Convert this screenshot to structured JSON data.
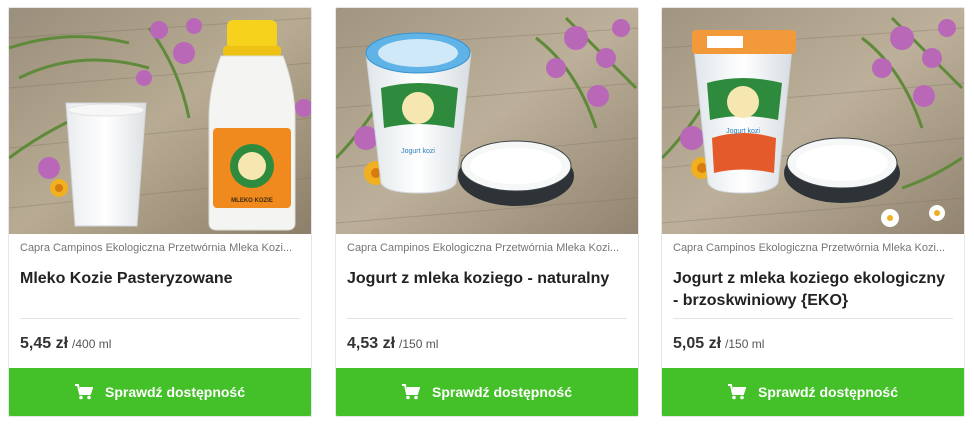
{
  "products": [
    {
      "producer": "Capra Campinos Ekologiczna Przetwórnia Mleka Kozi...",
      "title": "Mleko Kozie Pasteryzowane",
      "price": "5,45 zł",
      "unit": "/400 ml",
      "cta": "Sprawdź dostępność",
      "label_text": "MLEKO KOZIE"
    },
    {
      "producer": "Capra Campinos Ekologiczna Przetwórnia Mleka Kozi...",
      "title": "Jogurt z mleka koziego - naturalny",
      "price": "4,53 zł",
      "unit": "/150 ml",
      "cta": "Sprawdź dostępność",
      "label_text": "Jogurt kozi"
    },
    {
      "producer": "Capra Campinos Ekologiczna Przetwórnia Mleka Kozi...",
      "title": "Jogurt z mleka koziego ekologiczny - brzoskwiniowy {EKO}",
      "price": "5,05 zł",
      "unit": "/150 ml",
      "cta": "Sprawdź dostępność",
      "label_text": "Jogurt kozi"
    }
  ],
  "brand": {
    "name": "CAPRA CAMPINOS"
  },
  "colors": {
    "cta_green": "#44c029",
    "title_text": "#222222",
    "muted_text": "#757575"
  },
  "icons": {
    "cta": "cart-icon"
  }
}
